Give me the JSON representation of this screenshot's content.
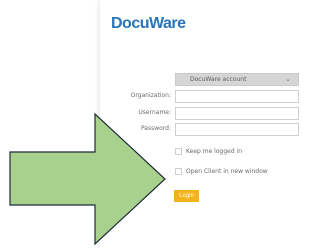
{
  "brand": {
    "logo_text": "DocuWare",
    "accent_color": "#2a75b8"
  },
  "form": {
    "account_select": {
      "selected": "DocuWare account"
    },
    "organization_label": "Organization:",
    "username_label": "Username:",
    "password_label": "Password:",
    "keep_logged_in_label": "Keep me logged in",
    "open_new_window_label": "Open Client in new window",
    "login_label": "Login"
  },
  "annotation": {
    "arrow_icon": "green-right-arrow-icon",
    "arrow_color": "#a9d18e",
    "login_color": "#f2b21b"
  }
}
